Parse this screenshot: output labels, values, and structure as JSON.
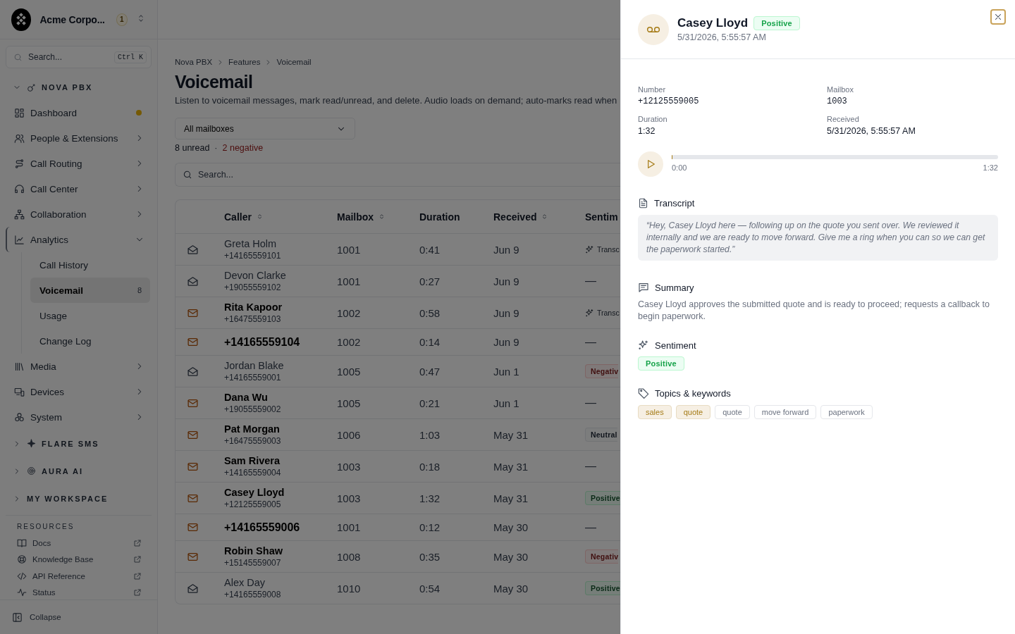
{
  "sidebar": {
    "org": {
      "name": "Acme Corpo...",
      "badge": "1"
    },
    "search": {
      "placeholder": "Search...",
      "shortcut": "Ctrl K"
    },
    "sections": [
      {
        "label": "NOVA PBX",
        "expanded": true,
        "items": [
          {
            "label": "Dashboard",
            "kind": "link",
            "notification": true,
            "selected": false
          },
          {
            "label": "People & Extensions",
            "kind": "group",
            "expanded": false,
            "selected": false
          },
          {
            "label": "Call Routing",
            "kind": "group",
            "expanded": false,
            "selected": false
          },
          {
            "label": "Call Center",
            "kind": "group",
            "expanded": false,
            "selected": false
          },
          {
            "label": "Collaboration",
            "kind": "group",
            "expanded": false,
            "selected": false
          },
          {
            "label": "Analytics",
            "kind": "group",
            "expanded": true,
            "selected": true,
            "children": [
              {
                "label": "Call History",
                "selected": false
              },
              {
                "label": "Voicemail",
                "selected": true,
                "count": "8"
              },
              {
                "label": "Usage",
                "selected": false
              },
              {
                "label": "Change Log",
                "selected": false
              }
            ]
          },
          {
            "label": "Media",
            "kind": "group",
            "expanded": false,
            "selected": false
          },
          {
            "label": "Devices",
            "kind": "group",
            "expanded": false,
            "selected": false
          },
          {
            "label": "System",
            "kind": "group",
            "expanded": false,
            "selected": false
          }
        ]
      },
      {
        "label": "FLARE SMS",
        "expanded": false
      },
      {
        "label": "AURA AI",
        "expanded": false
      },
      {
        "label": "MY WORKSPACE",
        "expanded": false
      }
    ],
    "resources": {
      "title": "RESOURCES",
      "links": [
        "Docs",
        "Knowledge Base",
        "API Reference",
        "Status"
      ]
    },
    "collapse": "Collapse"
  },
  "main": {
    "breadcrumb": [
      "Nova PBX",
      "Features",
      "Voicemail"
    ],
    "title": "Voicemail",
    "description": "Listen to voicemail messages, mark read/unread, and delete. Audio loads on demand; auto-marks read when",
    "filter": {
      "value": "All mailboxes"
    },
    "counts": {
      "unread": "8 unread",
      "separator": "·",
      "negative": "2 negative"
    },
    "search": {
      "placeholder": "Search..."
    },
    "table": {
      "columns": [
        {
          "label": "Caller",
          "sortable": true
        },
        {
          "label": "Mailbox",
          "sortable": true
        },
        {
          "label": "Duration",
          "sortable": false
        },
        {
          "label": "Received",
          "sortable": true
        },
        {
          "label": "Sentim",
          "sortable": false
        }
      ],
      "rows": [
        {
          "read": true,
          "name": "Greta Holm",
          "number": "+14165559101",
          "mailbox": "1001",
          "duration": "0:41",
          "received": "Jun 9",
          "sentiment": {
            "kind": "transcribing",
            "label": "Transc"
          }
        },
        {
          "read": true,
          "name": "Devon Clarke",
          "number": "+19055559102",
          "mailbox": "1001",
          "duration": "0:27",
          "received": "Jun 9",
          "sentiment": {
            "kind": "none",
            "label": "—"
          }
        },
        {
          "read": false,
          "name": "Rita Kapoor",
          "number": "+16475559103",
          "mailbox": "1002",
          "duration": "0:58",
          "received": "Jun 9",
          "sentiment": {
            "kind": "transcribing",
            "label": "Transc"
          }
        },
        {
          "read": false,
          "name": "+14165559104",
          "mailbox": "1002",
          "duration": "0:14",
          "received": "Jun 9",
          "sentiment": {
            "kind": "none",
            "label": "—"
          }
        },
        {
          "read": true,
          "name": "Jordan Blake",
          "number": "+14165559001",
          "mailbox": "1005",
          "duration": "0:47",
          "received": "Jun 1",
          "sentiment": {
            "kind": "negative",
            "label": "Negativ"
          }
        },
        {
          "read": false,
          "name": "Dana Wu",
          "number": "+19055559002",
          "mailbox": "1005",
          "duration": "0:21",
          "received": "Jun 1",
          "sentiment": {
            "kind": "none",
            "label": "—"
          }
        },
        {
          "read": false,
          "name": "Pat Morgan",
          "number": "+16475559003",
          "mailbox": "1006",
          "duration": "1:03",
          "received": "May 31",
          "sentiment": {
            "kind": "neutral",
            "label": "Neutral"
          }
        },
        {
          "read": false,
          "name": "Sam Rivera",
          "number": "+14165559004",
          "mailbox": "1003",
          "duration": "0:18",
          "received": "May 31",
          "sentiment": {
            "kind": "none",
            "label": "—"
          }
        },
        {
          "read": false,
          "name": "Casey Lloyd",
          "number": "+12125559005",
          "mailbox": "1003",
          "duration": "1:32",
          "received": "May 31",
          "sentiment": {
            "kind": "positive",
            "label": "Positive"
          }
        },
        {
          "read": false,
          "name": "+14165559006",
          "mailbox": "1001",
          "duration": "0:12",
          "received": "May 30",
          "sentiment": {
            "kind": "none",
            "label": "—"
          }
        },
        {
          "read": false,
          "name": "Robin Shaw",
          "number": "+15145559007",
          "mailbox": "1008",
          "duration": "0:35",
          "received": "May 30",
          "sentiment": {
            "kind": "negative",
            "label": "Negativ"
          }
        },
        {
          "read": true,
          "name": "Alex Day",
          "number": "+14165559008",
          "mailbox": "1010",
          "duration": "0:54",
          "received": "May 30",
          "sentiment": {
            "kind": "positive",
            "label": "Positive"
          }
        }
      ]
    }
  },
  "drawer": {
    "name": "Casey Lloyd",
    "sentiment": {
      "kind": "positive",
      "label": "Positive"
    },
    "timestamp": "5/31/2026, 5:55:57 AM",
    "fields": [
      {
        "label": "Number",
        "value": "+12125559005",
        "kind": "code"
      },
      {
        "label": "Mailbox",
        "value": "1003",
        "kind": "code"
      },
      {
        "label": "Duration",
        "value": "1:32",
        "kind": "text"
      },
      {
        "label": "Received",
        "value": "5/31/2026, 5:55:57 AM",
        "kind": "text"
      }
    ],
    "player": {
      "level": 0,
      "current": "0:00",
      "total": "1:32"
    },
    "transcript": {
      "title": "Transcript",
      "text": "“Hey, Casey Lloyd here — following up on the quote you sent over. We reviewed it internally and we are ready to move forward. Give me a ring when you can so we can get the paperwork started.”"
    },
    "summary": {
      "title": "Summary",
      "text": "Casey Lloyd approves the submitted quote and is ready to proceed; requests a callback to begin paperwork."
    },
    "sentiment_section": {
      "title": "Sentiment",
      "badge": {
        "kind": "positive",
        "label": "Positive"
      }
    },
    "topics": {
      "title": "Topics & keywords",
      "tags": [
        {
          "label": "sales",
          "kind": "topic"
        },
        {
          "label": "quote",
          "kind": "topic"
        },
        {
          "label": "quote",
          "kind": "keyword"
        },
        {
          "label": "move forward",
          "kind": "keyword"
        },
        {
          "label": "paperwork",
          "kind": "keyword"
        }
      ]
    }
  }
}
